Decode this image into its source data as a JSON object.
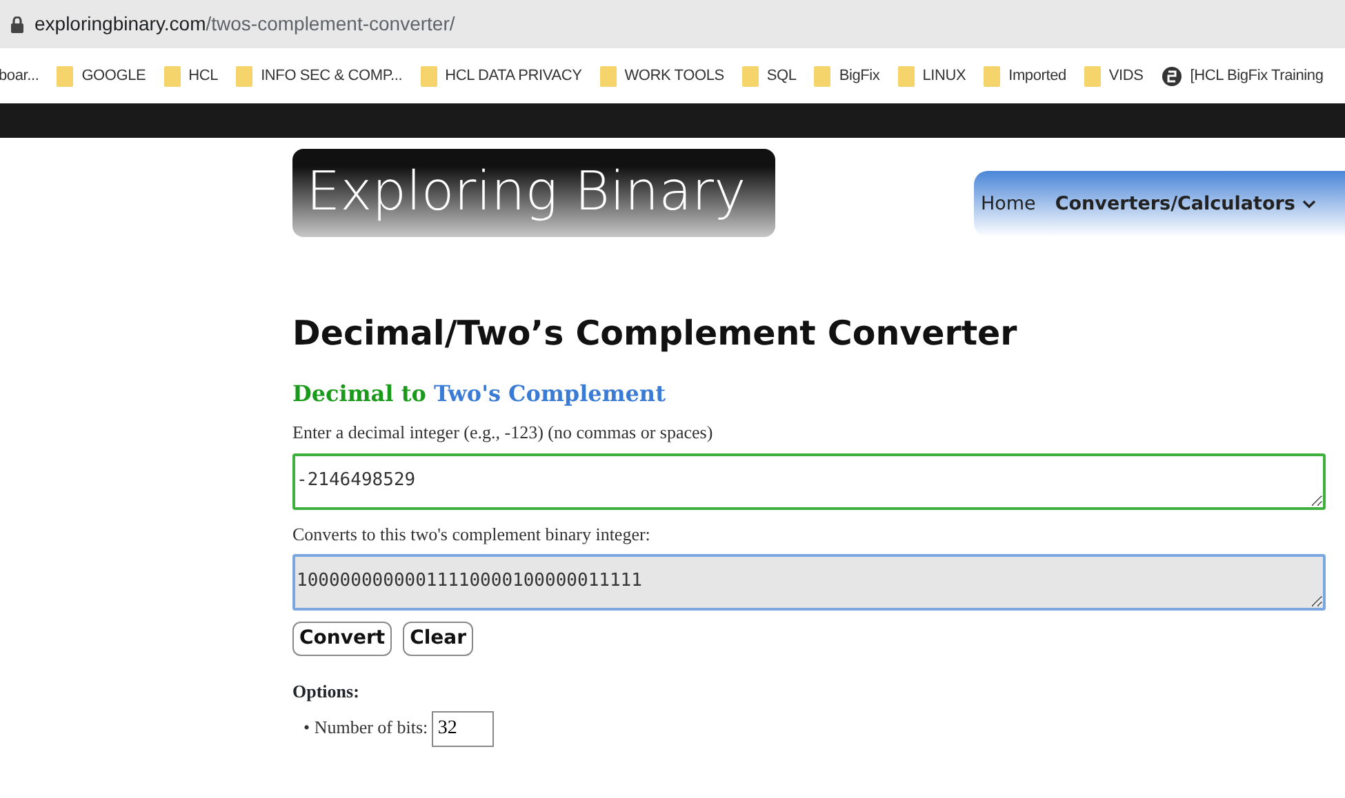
{
  "browser": {
    "url_host": "exploringbinary.com",
    "url_path": "/twos-complement-converter/",
    "bookmarks": [
      {
        "kind": "cut",
        "label": "boar..."
      },
      {
        "kind": "folder",
        "label": "GOOGLE"
      },
      {
        "kind": "folder",
        "label": "HCL"
      },
      {
        "kind": "folder",
        "label": "INFO SEC & COMP..."
      },
      {
        "kind": "folder",
        "label": "HCL DATA PRIVACY"
      },
      {
        "kind": "folder",
        "label": "WORK TOOLS"
      },
      {
        "kind": "folder",
        "label": "SQL"
      },
      {
        "kind": "folder",
        "label": "BigFix"
      },
      {
        "kind": "folder",
        "label": "LINUX"
      },
      {
        "kind": "folder",
        "label": "Imported"
      },
      {
        "kind": "folder",
        "label": "VIDS"
      },
      {
        "kind": "site",
        "label": "[HCL BigFix Training"
      }
    ]
  },
  "site": {
    "logo": "Exploring Binary",
    "nav": [
      {
        "label": "Home",
        "selected": false
      },
      {
        "label": "Converters/Calculators",
        "selected": true,
        "dropdown": true
      }
    ]
  },
  "page": {
    "title": "Decimal/Two’s Complement Converter",
    "section_title": {
      "part_1": "Decimal to",
      "part_2": "Two's Complement"
    },
    "input_label": "Enter a decimal integer (e.g., -123) (no commas or spaces)",
    "input_value": "-2146498529",
    "output_label": "Converts to this two's complement binary integer:",
    "output_value": "10000000000011110000100000011111",
    "buttons": [
      "Convert",
      "Clear"
    ],
    "options_title": "Options:",
    "options": [
      {
        "bullet": "•",
        "label": "Number of bits:",
        "value": "32"
      }
    ]
  }
}
